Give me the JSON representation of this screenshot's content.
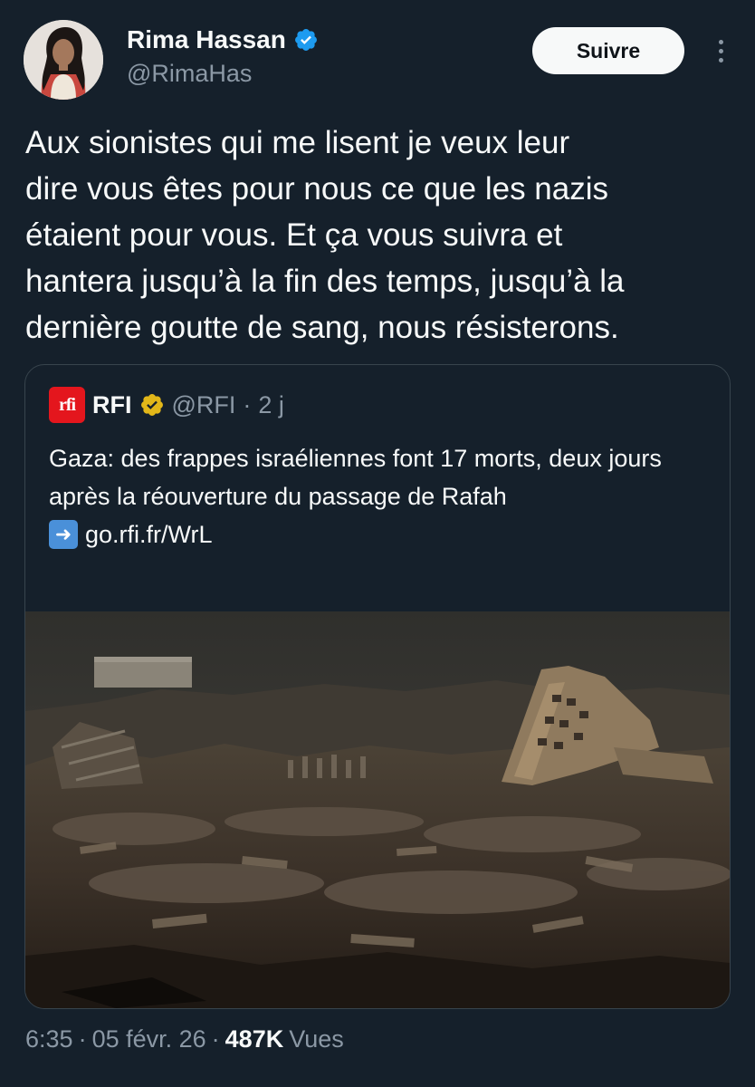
{
  "author": {
    "display_name": "Rima Hassan",
    "handle": "@RimaHas",
    "verified": true,
    "verified_color": "#1d9bf0"
  },
  "actions": {
    "follow_label": "Suivre",
    "more_icon": "more-vertical-icon"
  },
  "tweet": {
    "text": "Aux sionistes qui me lisent je veux leur\ndire vous êtes pour nous ce que les nazis\nétaient pour vous. Et ça vous suivra et\nhantera jusqu’à la fin des temps, jusqu’à la\ndernière goutte de sang, nous résisterons."
  },
  "quote": {
    "logo_text": "rfi",
    "display_name": "RFI",
    "verified_color": "#e2b719",
    "handle": "@RFI",
    "separator": "·",
    "time": "2 j",
    "text": "Gaza: des frappes israéliennes font 17 morts, deux jours après la réouverture du passage de Rafah",
    "link_icon": "right-arrow-emoji",
    "link_text": "go.rfi.fr/WrL",
    "image_description_icon": "photo-icon"
  },
  "meta": {
    "time": "6:35",
    "sep1": "·",
    "date": "05 févr. 26",
    "sep2": "·",
    "views_count": "487K",
    "views_label": "Vues"
  },
  "colors": {
    "background": "#15202b",
    "text": "#f7f9f9",
    "secondary_text": "#8b98a5",
    "border": "#38444d"
  }
}
